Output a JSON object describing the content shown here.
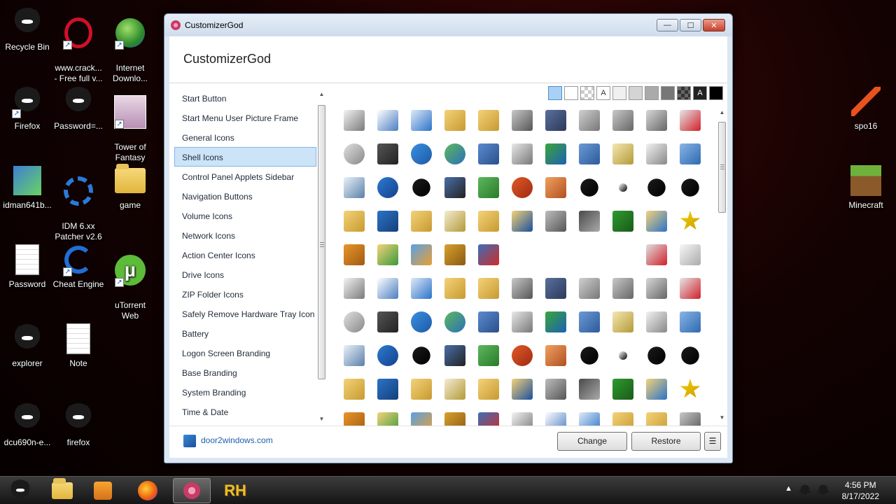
{
  "desktop": {
    "icons": [
      {
        "label": "Recycle Bin"
      },
      {
        "label": "www.crack...\n- Free full v..."
      },
      {
        "label": "Internet\nDownlo..."
      },
      {
        "label": "Firefox"
      },
      {
        "label": "Password=..."
      },
      {
        "label": "Tower of\nFantasy"
      },
      {
        "label": "idman641b..."
      },
      {
        "label": "IDM 6.xx\nPatcher v2.6"
      },
      {
        "label": "game"
      },
      {
        "label": "Password"
      },
      {
        "label": "Cheat Engine"
      },
      {
        "label": "uTorrent\nWeb"
      },
      {
        "label": "explorer"
      },
      {
        "label": "Note"
      },
      {
        "label": "dcu690n-e..."
      },
      {
        "label": "firefox"
      },
      {
        "label": "spo16"
      },
      {
        "label": "Minecraft"
      }
    ]
  },
  "window": {
    "title": "CustomizerGod",
    "header": "CustomizerGod",
    "controls": {
      "minimize": "—",
      "maximize": "☐",
      "close": "✕"
    },
    "categories": [
      {
        "label": "Start Button"
      },
      {
        "label": "Start Menu User Picture Frame"
      },
      {
        "label": "General Icons"
      },
      {
        "label": "Shell Icons",
        "selected": true
      },
      {
        "label": "Control Panel Applets Sidebar"
      },
      {
        "label": "Navigation Buttons"
      },
      {
        "label": "Volume Icons"
      },
      {
        "label": "Network Icons"
      },
      {
        "label": "Action Center Icons"
      },
      {
        "label": "Drive Icons"
      },
      {
        "label": "ZIP Folder Icons"
      },
      {
        "label": "Safely Remove Hardware Tray Icon"
      },
      {
        "label": "Battery"
      },
      {
        "label": "Logon Screen Branding"
      },
      {
        "label": "Base Branding"
      },
      {
        "label": "System Branding"
      },
      {
        "label": "Time & Date"
      }
    ],
    "swatch_text": "A",
    "footer": {
      "link": "door2windows.com",
      "change": "Change",
      "restore": "Restore",
      "menu": "☰"
    }
  },
  "taskbar": {
    "time": "4:56 PM",
    "date": "8/17/2022",
    "tray_arrow": "▲",
    "active_app": "CustomizerGod",
    "rh_label": "RH"
  },
  "colors": {
    "selection": "#cce4f7",
    "selection_border": "#7eb4ea",
    "link": "#1f5fa8",
    "title_close": "#c8412b"
  }
}
